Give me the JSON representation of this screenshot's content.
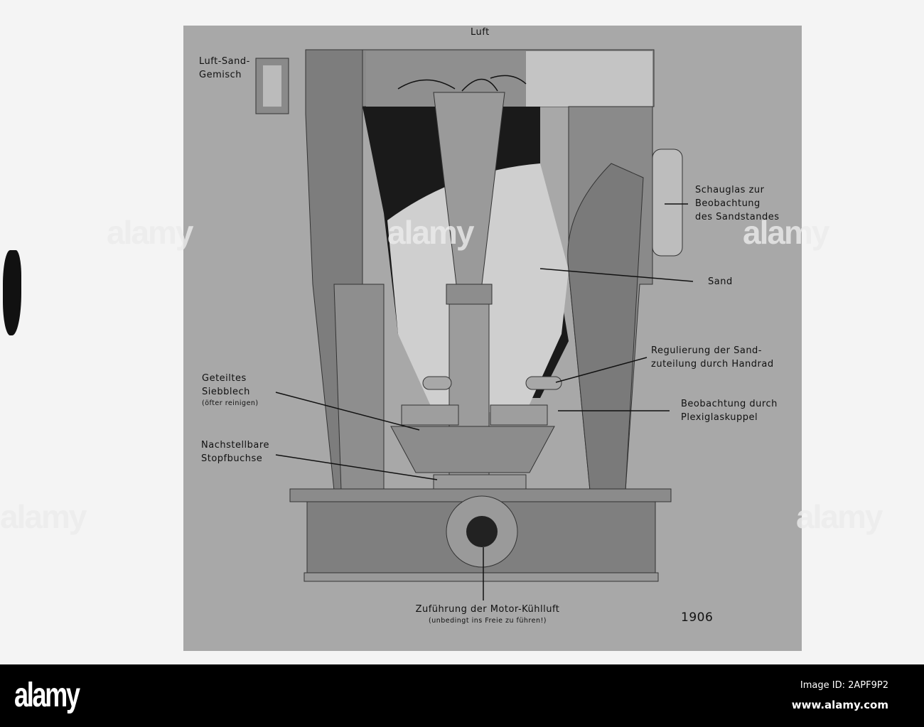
{
  "labels": {
    "luft": "Luft",
    "luft_sand_gemisch": [
      "Luft-Sand-",
      "Gemisch"
    ],
    "schauglas": [
      "Schauglas zur",
      "Beobachtung",
      "des Sandstandes"
    ],
    "sand": "Sand",
    "regulierung": [
      "Regulierung der Sand-",
      "zuteilung durch Handrad"
    ],
    "beobachtung": [
      "Beobachtung durch",
      "Plexiglaskuppel"
    ],
    "siebblech": [
      "Geteiltes",
      "Siebblech",
      "(öfter reinigen)"
    ],
    "stopfbuchse": [
      "Nachstellbare",
      "Stopfbuchse"
    ],
    "zufuehrung": [
      "Zuführung der Motor-Kühlluft",
      "(unbedingt ins Freie zu führen!)"
    ],
    "figure_number": "1906"
  },
  "watermark": "alamy",
  "footer": {
    "logo": "alamy",
    "image_id": "Image ID: 2APF9P2",
    "url": "www.alamy.com"
  }
}
